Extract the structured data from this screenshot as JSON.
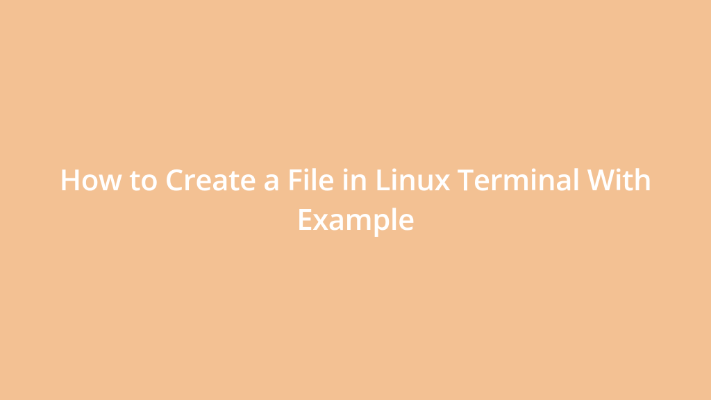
{
  "title": "How to Create a File in Linux Terminal With Example"
}
